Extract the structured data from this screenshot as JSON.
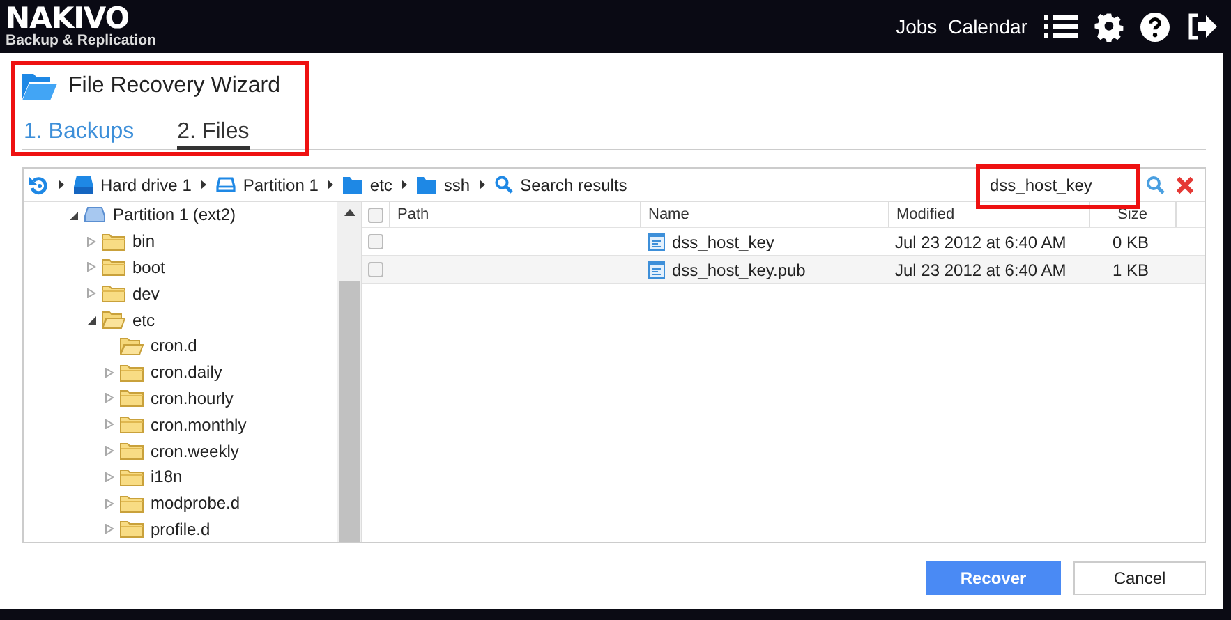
{
  "top_bar": {
    "logo": "NAKIVO",
    "logo_subtitle": "Backup & Replication",
    "links": [
      "Jobs",
      "Calendar"
    ]
  },
  "wizard": {
    "title": "File Recovery Wizard",
    "highlighted": true,
    "steps": [
      {
        "label": "1. Backups",
        "selected": false
      },
      {
        "label": "2. Files",
        "selected": true
      }
    ]
  },
  "breadcrumb": [
    {
      "kind": "drive",
      "label": "Hard drive 1"
    },
    {
      "kind": "partition",
      "label": "Partition 1"
    },
    {
      "kind": "folder",
      "label": "etc"
    },
    {
      "kind": "folder",
      "label": "ssh"
    },
    {
      "kind": "search",
      "label": "Search results"
    }
  ],
  "search": {
    "value": "dss_host_key",
    "highlighted": true
  },
  "tree": [
    {
      "kind": "partition",
      "label": "Partition 1 (ext2)",
      "expanded": true,
      "children": [
        {
          "kind": "folder",
          "label": "bin",
          "expanded": false
        },
        {
          "kind": "folder",
          "label": "boot",
          "expanded": false
        },
        {
          "kind": "folder",
          "label": "dev",
          "expanded": false
        },
        {
          "kind": "folder",
          "label": "etc",
          "expanded": true,
          "children": [
            {
              "kind": "folder",
              "label": "cron.d"
            },
            {
              "kind": "folder",
              "label": "cron.daily",
              "expanded": false
            },
            {
              "kind": "folder",
              "label": "cron.hourly",
              "expanded": false
            },
            {
              "kind": "folder",
              "label": "cron.monthly",
              "expanded": false
            },
            {
              "kind": "folder",
              "label": "cron.weekly",
              "expanded": false
            },
            {
              "kind": "folder",
              "label": "i18n",
              "expanded": false
            },
            {
              "kind": "folder",
              "label": "modprobe.d",
              "expanded": false
            },
            {
              "kind": "folder",
              "label": "profile.d",
              "expanded": false
            }
          ]
        }
      ]
    }
  ],
  "table": {
    "columns": [
      "Path",
      "Name",
      "Modified",
      "Size"
    ],
    "all_checked": false,
    "rows": [
      {
        "checked": false,
        "path": "",
        "name": "dss_host_key",
        "modified": "Jul 23 2012 at 6:40 AM",
        "size": "0 KB"
      },
      {
        "checked": false,
        "path": "",
        "name": "dss_host_key.pub",
        "modified": "Jul 23 2012 at 6:40 AM",
        "size": "1 KB"
      }
    ]
  },
  "buttons": [
    {
      "kind": "primary",
      "label": "Recover"
    },
    {
      "kind": "secondary",
      "label": "Cancel"
    }
  ]
}
